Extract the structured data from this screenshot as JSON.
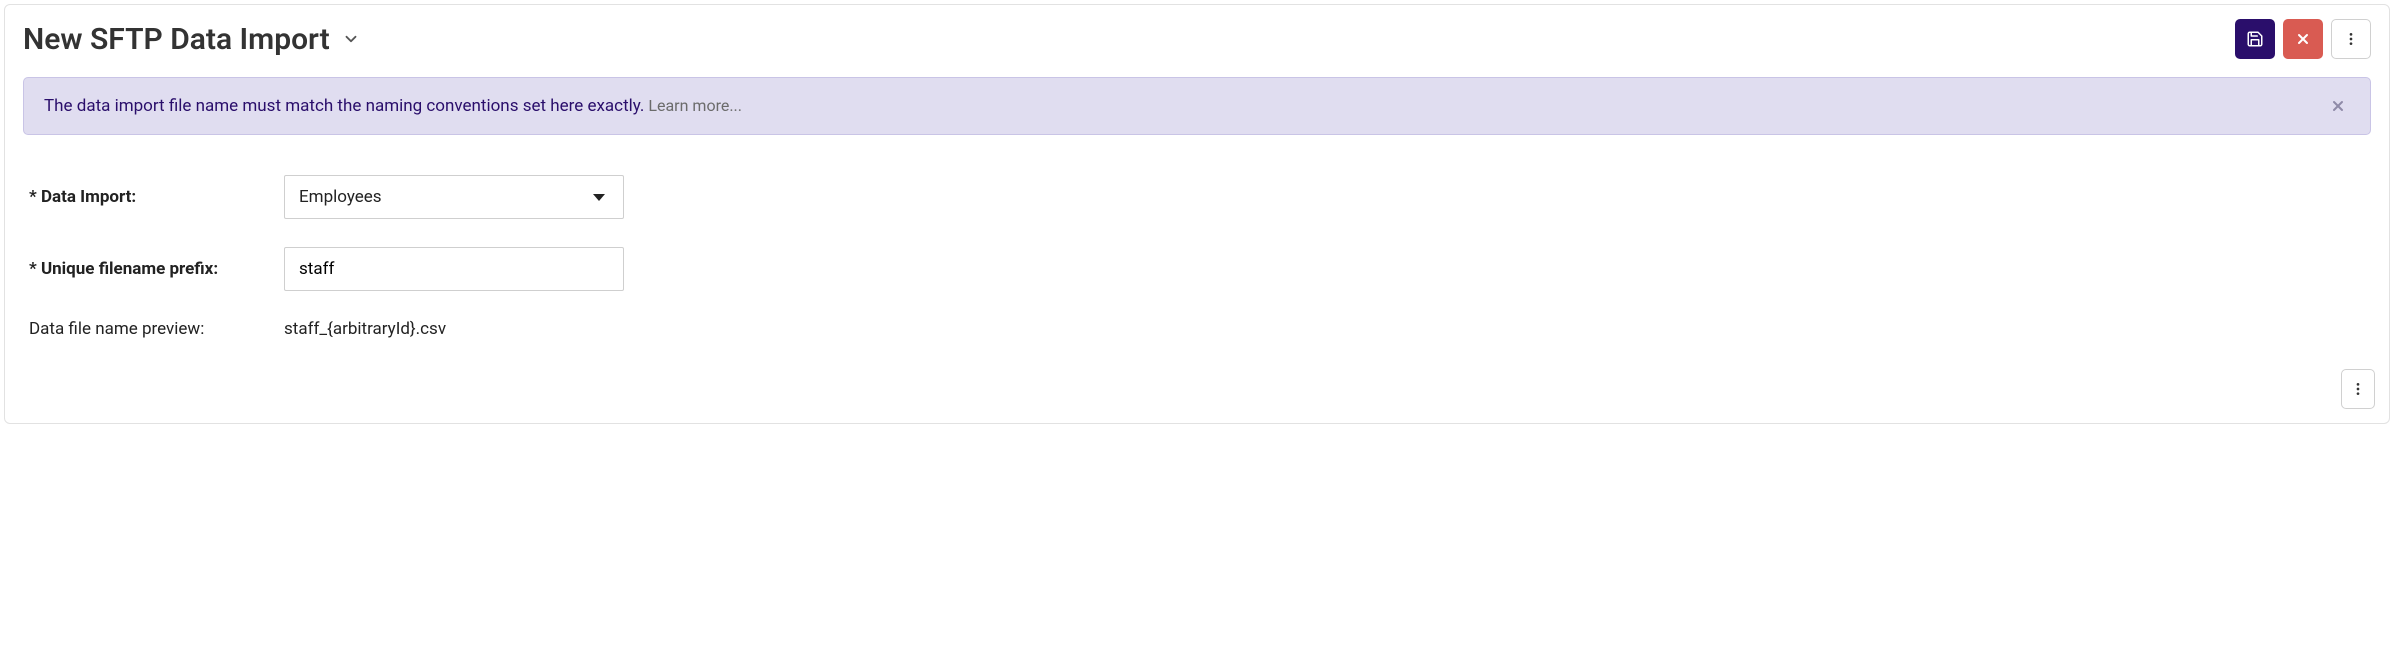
{
  "header": {
    "title": "New SFTP Data Import"
  },
  "banner": {
    "message": "The data import file name must match the naming conventions set here exactly.",
    "link_text": "Learn more..."
  },
  "form": {
    "data_import_label": "* Data Import:",
    "data_import_value": "Employees",
    "prefix_label": "* Unique filename prefix:",
    "prefix_value": "staff",
    "preview_label": "Data file name preview:",
    "preview_value": "staff_{arbitraryId}.csv"
  }
}
